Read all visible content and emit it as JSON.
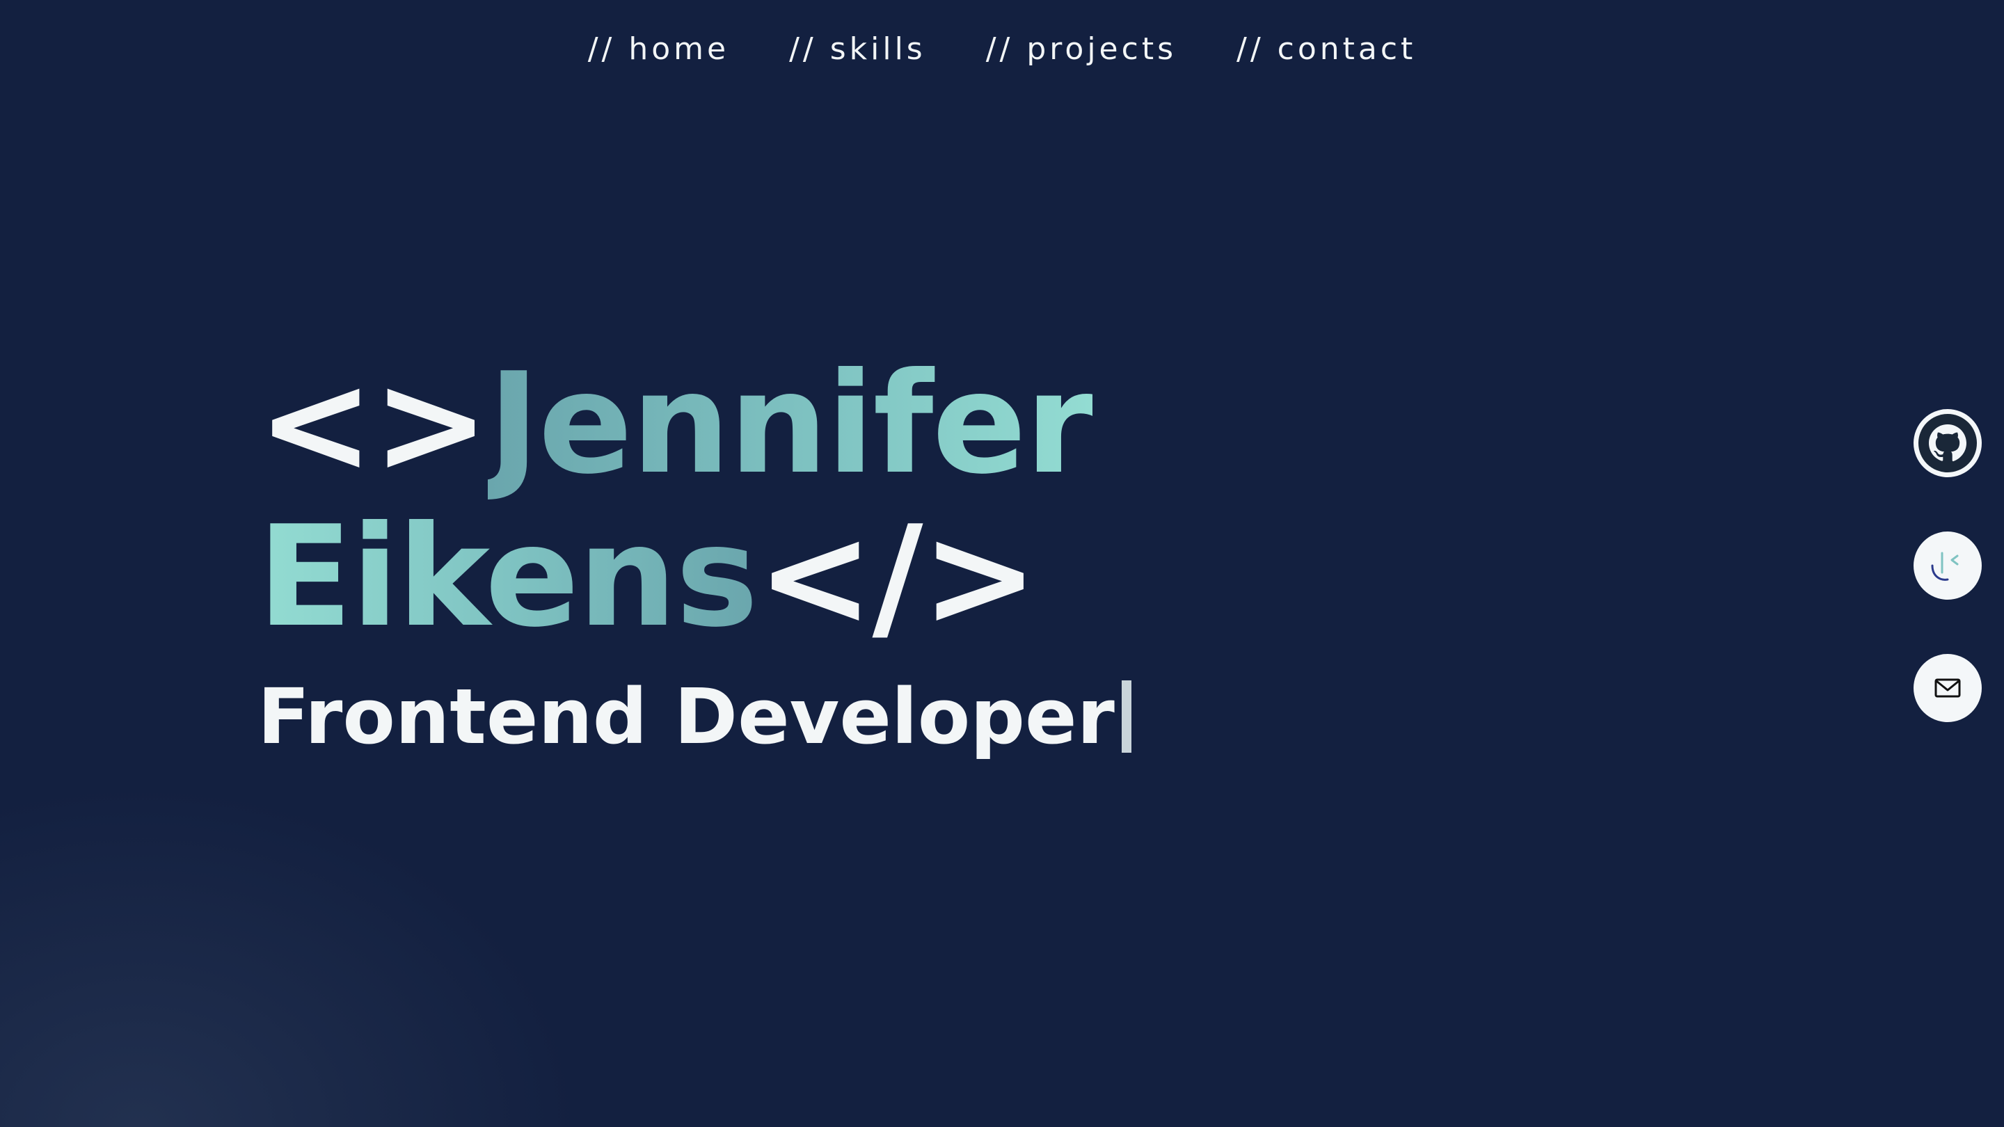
{
  "nav": {
    "items": [
      {
        "label": "// home"
      },
      {
        "label": "// skills"
      },
      {
        "label": "// projects"
      },
      {
        "label": "// contact"
      }
    ]
  },
  "hero": {
    "open_tag": "<>",
    "first_name": "Jennifer",
    "last_name": "Eikens",
    "close_tag": "</>",
    "role": "Frontend Developer"
  },
  "social": {
    "icons": [
      "github-icon",
      "codersrank-icon",
      "mail-icon"
    ]
  },
  "colors": {
    "background": "#132040",
    "accent_gradient_start": "#6aa6ad",
    "accent_gradient_end": "#93dcd2",
    "text": "#f3f6f7"
  }
}
